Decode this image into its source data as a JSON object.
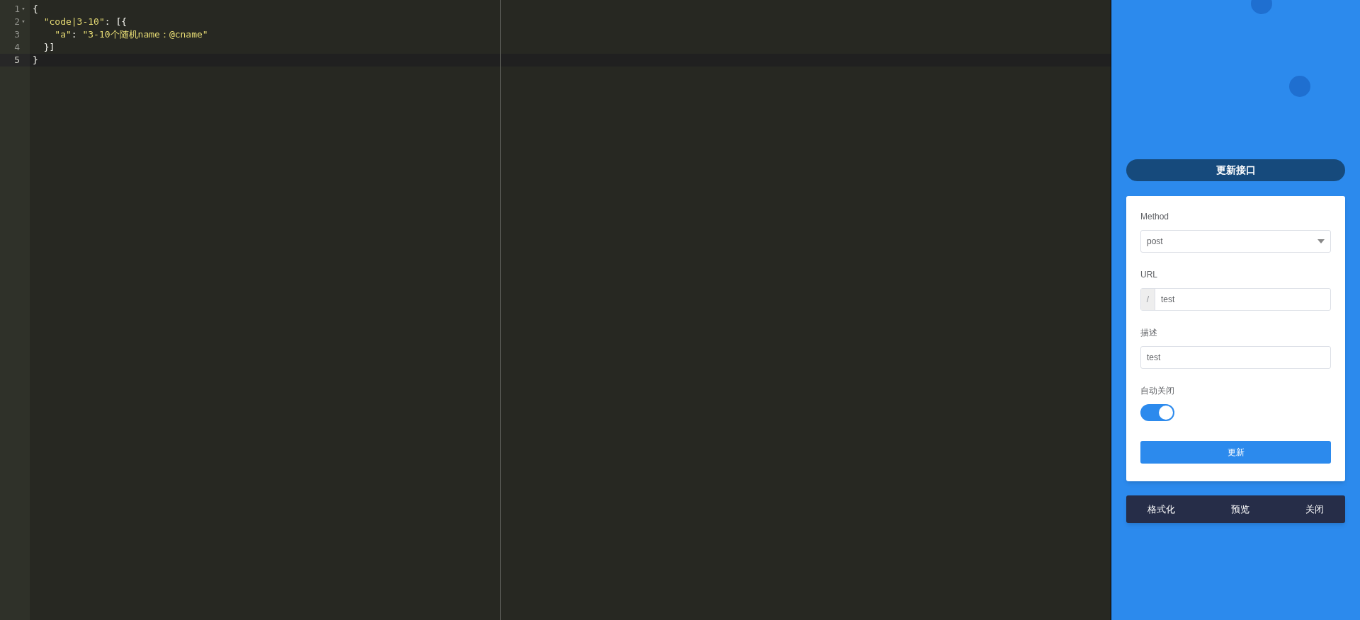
{
  "editor": {
    "lines": [
      {
        "number": "1",
        "fold_marker": "▾",
        "active": false,
        "tokens": [
          {
            "kind": "punct",
            "text": "{"
          }
        ]
      },
      {
        "number": "2",
        "fold_marker": "▾",
        "active": false,
        "tokens": [
          {
            "kind": "string",
            "text": "  \"code|3-10\""
          },
          {
            "kind": "punct",
            "text": ": [{"
          }
        ]
      },
      {
        "number": "3",
        "active": false,
        "tokens": [
          {
            "kind": "string",
            "text": "    \"a\""
          },
          {
            "kind": "punct",
            "text": ": "
          },
          {
            "kind": "string",
            "text": "\"3-10个随机name：@cname\""
          }
        ]
      },
      {
        "number": "4",
        "active": false,
        "tokens": [
          {
            "kind": "punct",
            "text": "  }]"
          }
        ]
      },
      {
        "number": "5",
        "active": true,
        "tokens": [
          {
            "kind": "punct",
            "text": "}"
          }
        ]
      }
    ]
  },
  "panel": {
    "title": "更新接口",
    "form": {
      "method": {
        "label": "Method",
        "value": "post"
      },
      "url": {
        "label": "URL",
        "prefix": "/",
        "value": "test"
      },
      "description": {
        "label": "描述",
        "value": "test"
      },
      "auto_close": {
        "label": "自动关闭",
        "on": true
      },
      "submit": "更新"
    },
    "actions": [
      "格式化",
      "预览",
      "关闭"
    ]
  }
}
